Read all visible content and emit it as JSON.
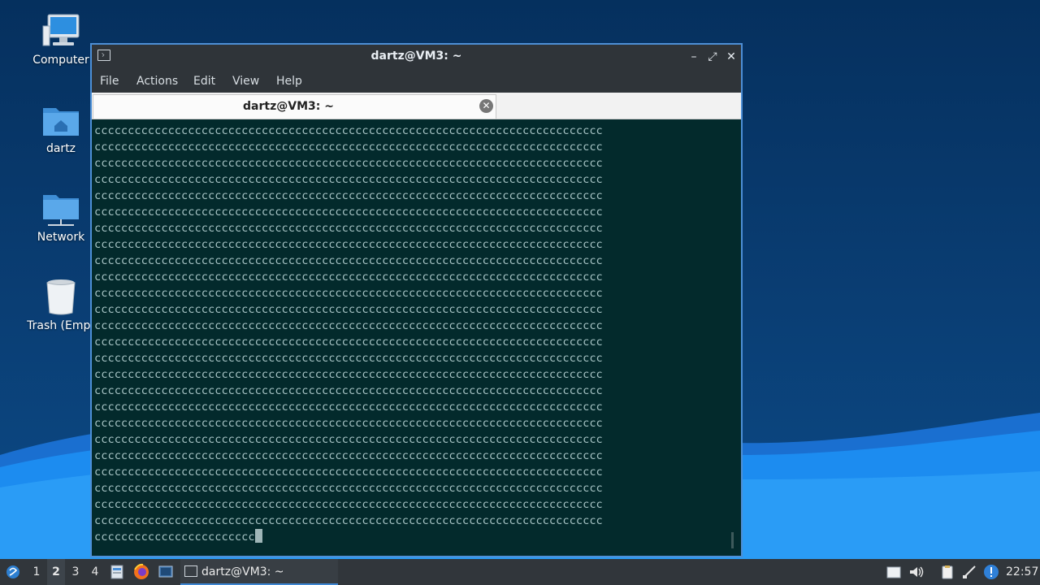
{
  "desktop": {
    "icons": [
      {
        "label": "Computer",
        "icon": "computer-icon"
      },
      {
        "label": "dartz",
        "icon": "home-folder-icon"
      },
      {
        "label": "Network",
        "icon": "network-folder-icon"
      },
      {
        "label": "Trash (Empt",
        "icon": "trash-icon"
      }
    ]
  },
  "window": {
    "title": "dartz@VM3: ~",
    "menu": [
      "File",
      "Actions",
      "Edit",
      "View",
      "Help"
    ],
    "tab_title": "dartz@VM3: ~",
    "terminal": {
      "full_line": "cccccccccccccccccccccccccccccccccccccccccccccccccccccccccccccccccccccccccccc",
      "full_line_count": 25,
      "last_line": "cccccccccccccccccccccccc"
    }
  },
  "taskbar": {
    "desktops": [
      "1",
      "2",
      "3",
      "4"
    ],
    "active_desktop": "2",
    "task_label": "dartz@VM3: ~",
    "clock": "22:57"
  },
  "colors": {
    "accent": "#3e86d2",
    "terminal_bg": "#032a2c",
    "terminal_fg": "#a7c4c5",
    "titlebar": "#2f3439",
    "taskbar": "#31363b"
  }
}
